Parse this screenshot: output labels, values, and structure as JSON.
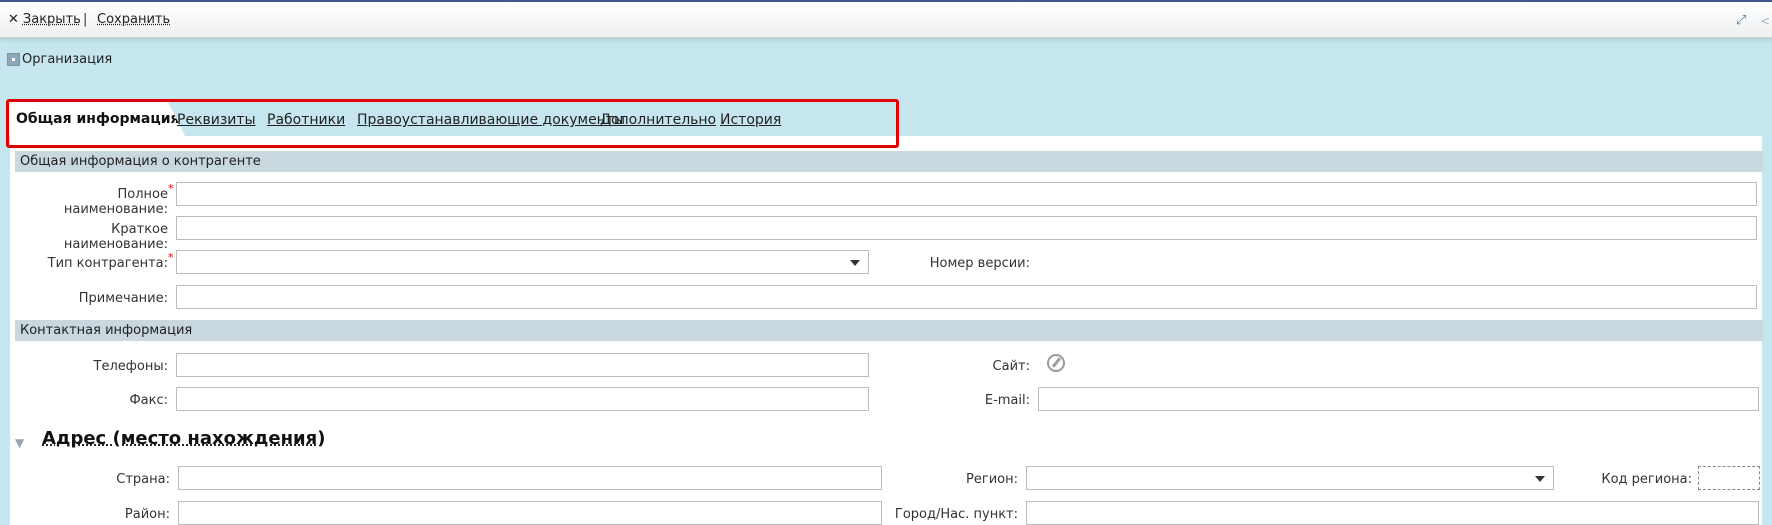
{
  "toolbar": {
    "close_label": "Закрыть",
    "separator": "|",
    "save_label": "Сохранить",
    "close_glyph": "✕",
    "expand_glyph": "⤢",
    "edge_glyph": "<"
  },
  "breadcrumb": {
    "label": "Организация"
  },
  "tabs": [
    {
      "label": "Общая информация",
      "active": true
    },
    {
      "label": "Реквизиты"
    },
    {
      "label": "Работники"
    },
    {
      "label": "Правоустанавливающие документы"
    },
    {
      "label": "Дополнительно"
    },
    {
      "label": "История"
    }
  ],
  "general": {
    "title": "Общая информация о контрагенте",
    "full_name_label": "Полное наименование:",
    "short_name_label": "Краткое наименование:",
    "type_label": "Тип контрагента:",
    "version_label": "Номер версии:",
    "note_label": "Примечание:",
    "required_mark": "*"
  },
  "contact": {
    "title": "Контактная информация",
    "phones_label": "Телефоны:",
    "site_label": "Сайт:",
    "fax_label": "Факс:",
    "email_label": "E-mail:"
  },
  "address": {
    "title": "Адрес (место нахождения)",
    "collapse_glyph": "▼",
    "country_label": "Страна:",
    "region_label": "Регион:",
    "region_code_label": "Код региона:",
    "district_label": "Район:",
    "city_label": "Город/Нас. пункт:"
  },
  "colors": {
    "background": "#c5e6ef",
    "section_bar": "#c9d7de",
    "highlight": "#e00000",
    "required": "#d00000"
  }
}
